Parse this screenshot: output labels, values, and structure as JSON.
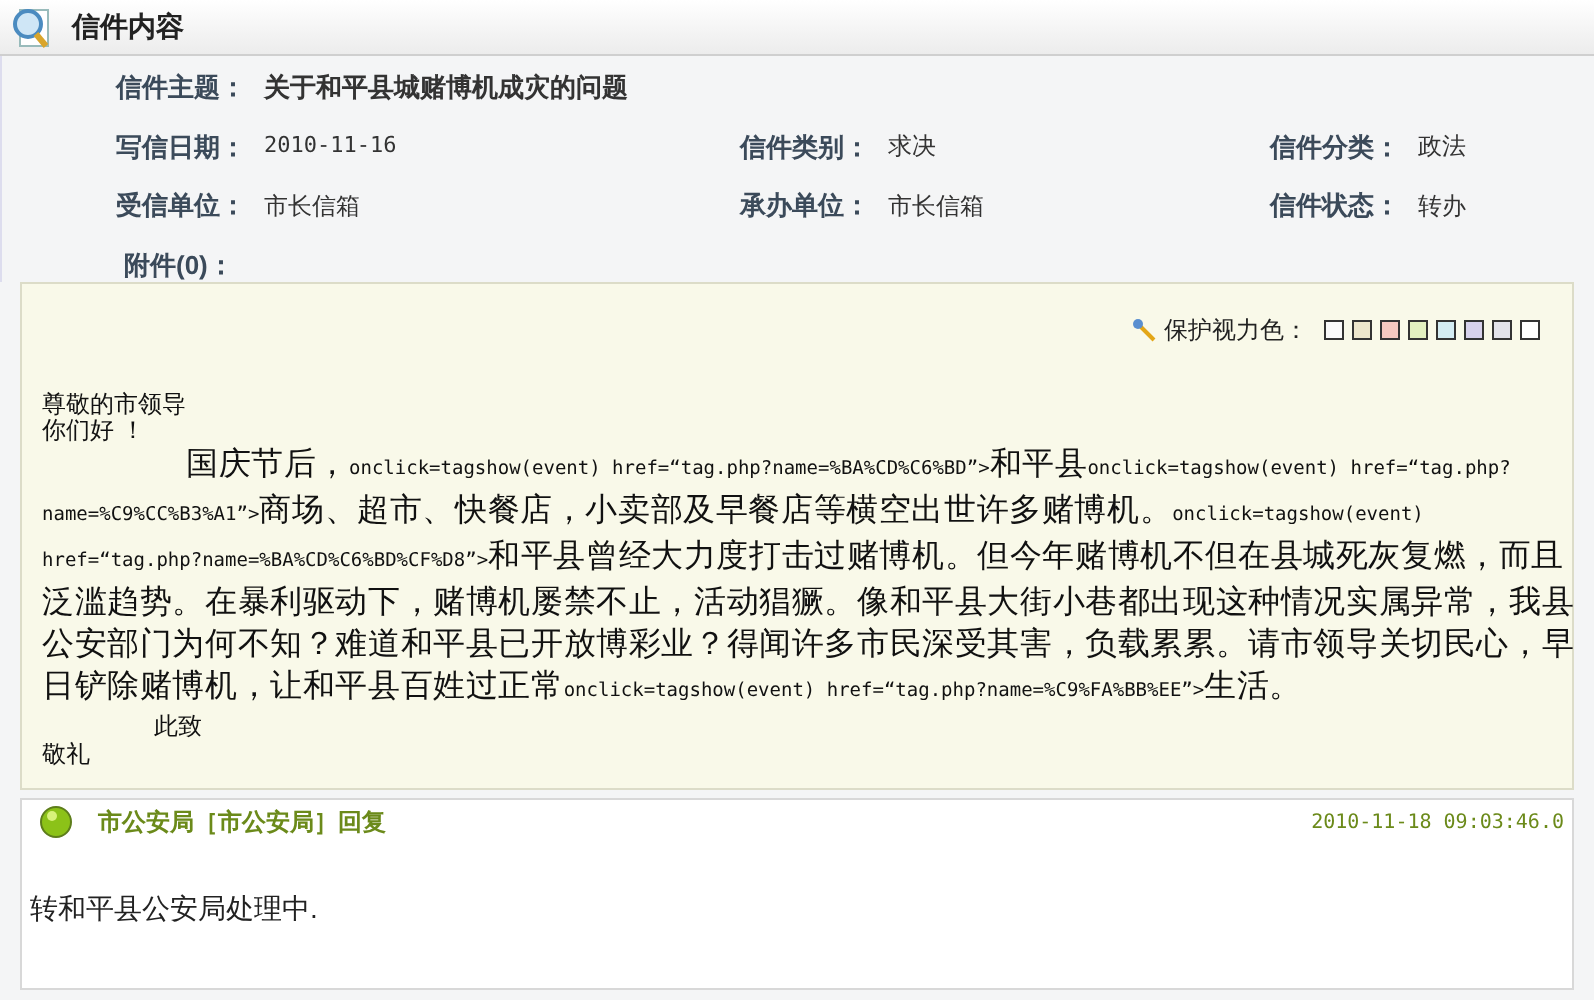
{
  "header": {
    "title": "信件内容"
  },
  "fields": [
    {
      "label": "信件主题：",
      "value": "关于和平县城赌博机成灾的问题",
      "kind": "subject"
    },
    {
      "label": "写信日期：",
      "value": "2010-11-16",
      "kind": "date"
    },
    {
      "label": "信件类别：",
      "value": "求决",
      "kind": "plain"
    },
    {
      "label": "信件分类：",
      "value": "政法",
      "kind": "plain"
    },
    {
      "label": "受信单位：",
      "value": "市长信箱",
      "kind": "plain"
    },
    {
      "label": "承办单位：",
      "value": "市长信箱",
      "kind": "plain"
    },
    {
      "label": "信件状态：",
      "value": "转办",
      "kind": "plain"
    },
    {
      "label": "附件(0)：",
      "kind": "attachment"
    }
  ],
  "eye_protection": {
    "label": "保护视力色：",
    "swatches": [
      {
        "color": "#fafafa"
      },
      {
        "color": "#ede6cc"
      },
      {
        "color": "#f5c8c0"
      },
      {
        "color": "#e2f0c0"
      },
      {
        "color": "#d4ecf2"
      },
      {
        "color": "#d8d2ec"
      },
      {
        "color": "#e2e2ea"
      },
      {
        "color": "#ffffff"
      }
    ]
  },
  "letter": {
    "greeting": [
      "尊敬的市领导",
      "你们好 ！"
    ],
    "lines": [
      [
        {
          "kind": "text",
          "text": "国庆节后，",
          "indent": true
        },
        {
          "kind": "code",
          "text": "onclick=tagshow(event) href=“tag.php?name=%BA%CD%C6%BD”>"
        },
        {
          "kind": "text",
          "text": "和平县"
        },
        {
          "kind": "code",
          "text": "onclick=tagshow(event) href=“tag.php?"
        }
      ],
      [
        {
          "kind": "code",
          "text": "name=%C9%CC%B3%A1”>"
        },
        {
          "kind": "text",
          "text": "商场、超市、快餐店，小卖部及早餐店等横空出世许多赌博机。"
        },
        {
          "kind": "code",
          "text": "onclick=tagshow(event)"
        }
      ],
      [
        {
          "kind": "code",
          "text": "href=“tag.php?name=%BA%CD%C6%BD%CF%D8”>"
        },
        {
          "kind": "text",
          "text": "和平县曾经大力度打击过赌博机。但今年赌博机不但在县城死灰复燃，而且"
        }
      ],
      [
        {
          "kind": "text",
          "text": "泛滥趋势。在暴利驱动下，赌博机屡禁不止，活动猖獗。像和平县大街小巷都出现这种情况实属异常，我县"
        }
      ],
      [
        {
          "kind": "text",
          "text": "公安部门为何不知？难道和平县已开放博彩业？得闻许多市民深受其害，负载累累。请市领导关切民心，早"
        }
      ],
      [
        {
          "kind": "text",
          "text": "日铲除赌博机，让和平县百姓过正常"
        },
        {
          "kind": "code",
          "text": "onclick=tagshow(event) href=“tag.php?name=%C9%FA%BB%EE”>"
        },
        {
          "kind": "text",
          "text": "生活。"
        }
      ]
    ],
    "closing": [
      "此致",
      "敬礼"
    ]
  },
  "reply": {
    "author": "市公安局［市公安局］回复",
    "time": "2010-11-18 09:03:46.0",
    "text": "转和平县公安局处理中."
  }
}
